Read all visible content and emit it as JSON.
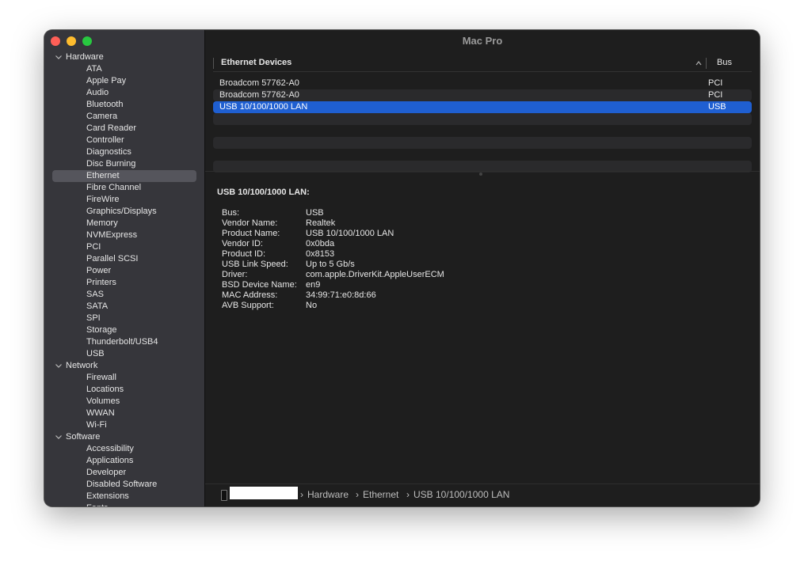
{
  "window": {
    "title": "Mac Pro"
  },
  "colors": {
    "selection": "#1f5fd1",
    "sidebar_selection": "#55555c"
  },
  "sidebar": {
    "groups": [
      {
        "label": "Hardware",
        "items": [
          "ATA",
          "Apple Pay",
          "Audio",
          "Bluetooth",
          "Camera",
          "Card Reader",
          "Controller",
          "Diagnostics",
          "Disc Burning",
          "Ethernet",
          "Fibre Channel",
          "FireWire",
          "Graphics/Displays",
          "Memory",
          "NVMExpress",
          "PCI",
          "Parallel SCSI",
          "Power",
          "Printers",
          "SAS",
          "SATA",
          "SPI",
          "Storage",
          "Thunderbolt/USB4",
          "USB"
        ]
      },
      {
        "label": "Network",
        "items": [
          "Firewall",
          "Locations",
          "Volumes",
          "WWAN",
          "Wi-Fi"
        ]
      },
      {
        "label": "Software",
        "items": [
          "Accessibility",
          "Applications",
          "Developer",
          "Disabled Software",
          "Extensions",
          "Fonts"
        ]
      }
    ],
    "selected": "Ethernet"
  },
  "table": {
    "columns": [
      "Ethernet Devices",
      "Bus"
    ],
    "rows": [
      {
        "name": "Broadcom 57762-A0",
        "bus": "PCI"
      },
      {
        "name": "Broadcom 57762-A0",
        "bus": "PCI"
      },
      {
        "name": "USB 10/100/1000 LAN",
        "bus": "USB"
      }
    ]
  },
  "detail": {
    "title": "USB 10/100/1000 LAN:",
    "fields": [
      {
        "k": "Bus:",
        "v": "USB"
      },
      {
        "k": "Vendor Name:",
        "v": "Realtek"
      },
      {
        "k": "Product Name:",
        "v": "USB 10/100/1000 LAN"
      },
      {
        "k": "Vendor ID:",
        "v": "0x0bda"
      },
      {
        "k": "Product ID:",
        "v": "0x8153"
      },
      {
        "k": "USB Link Speed:",
        "v": "Up to 5 Gb/s"
      },
      {
        "k": "Driver:",
        "v": "com.apple.DriverKit.AppleUserECM"
      },
      {
        "k": "BSD Device Name:",
        "v": "en9"
      },
      {
        "k": "MAC Address:",
        "v": "34:99:71:e0:8d:66"
      },
      {
        "k": "AVB Support:",
        "v": "No"
      }
    ]
  },
  "pathbar": {
    "crumbs": [
      "Hardware",
      "Ethernet",
      "USB 10/100/1000 LAN"
    ],
    "separator": "›"
  }
}
